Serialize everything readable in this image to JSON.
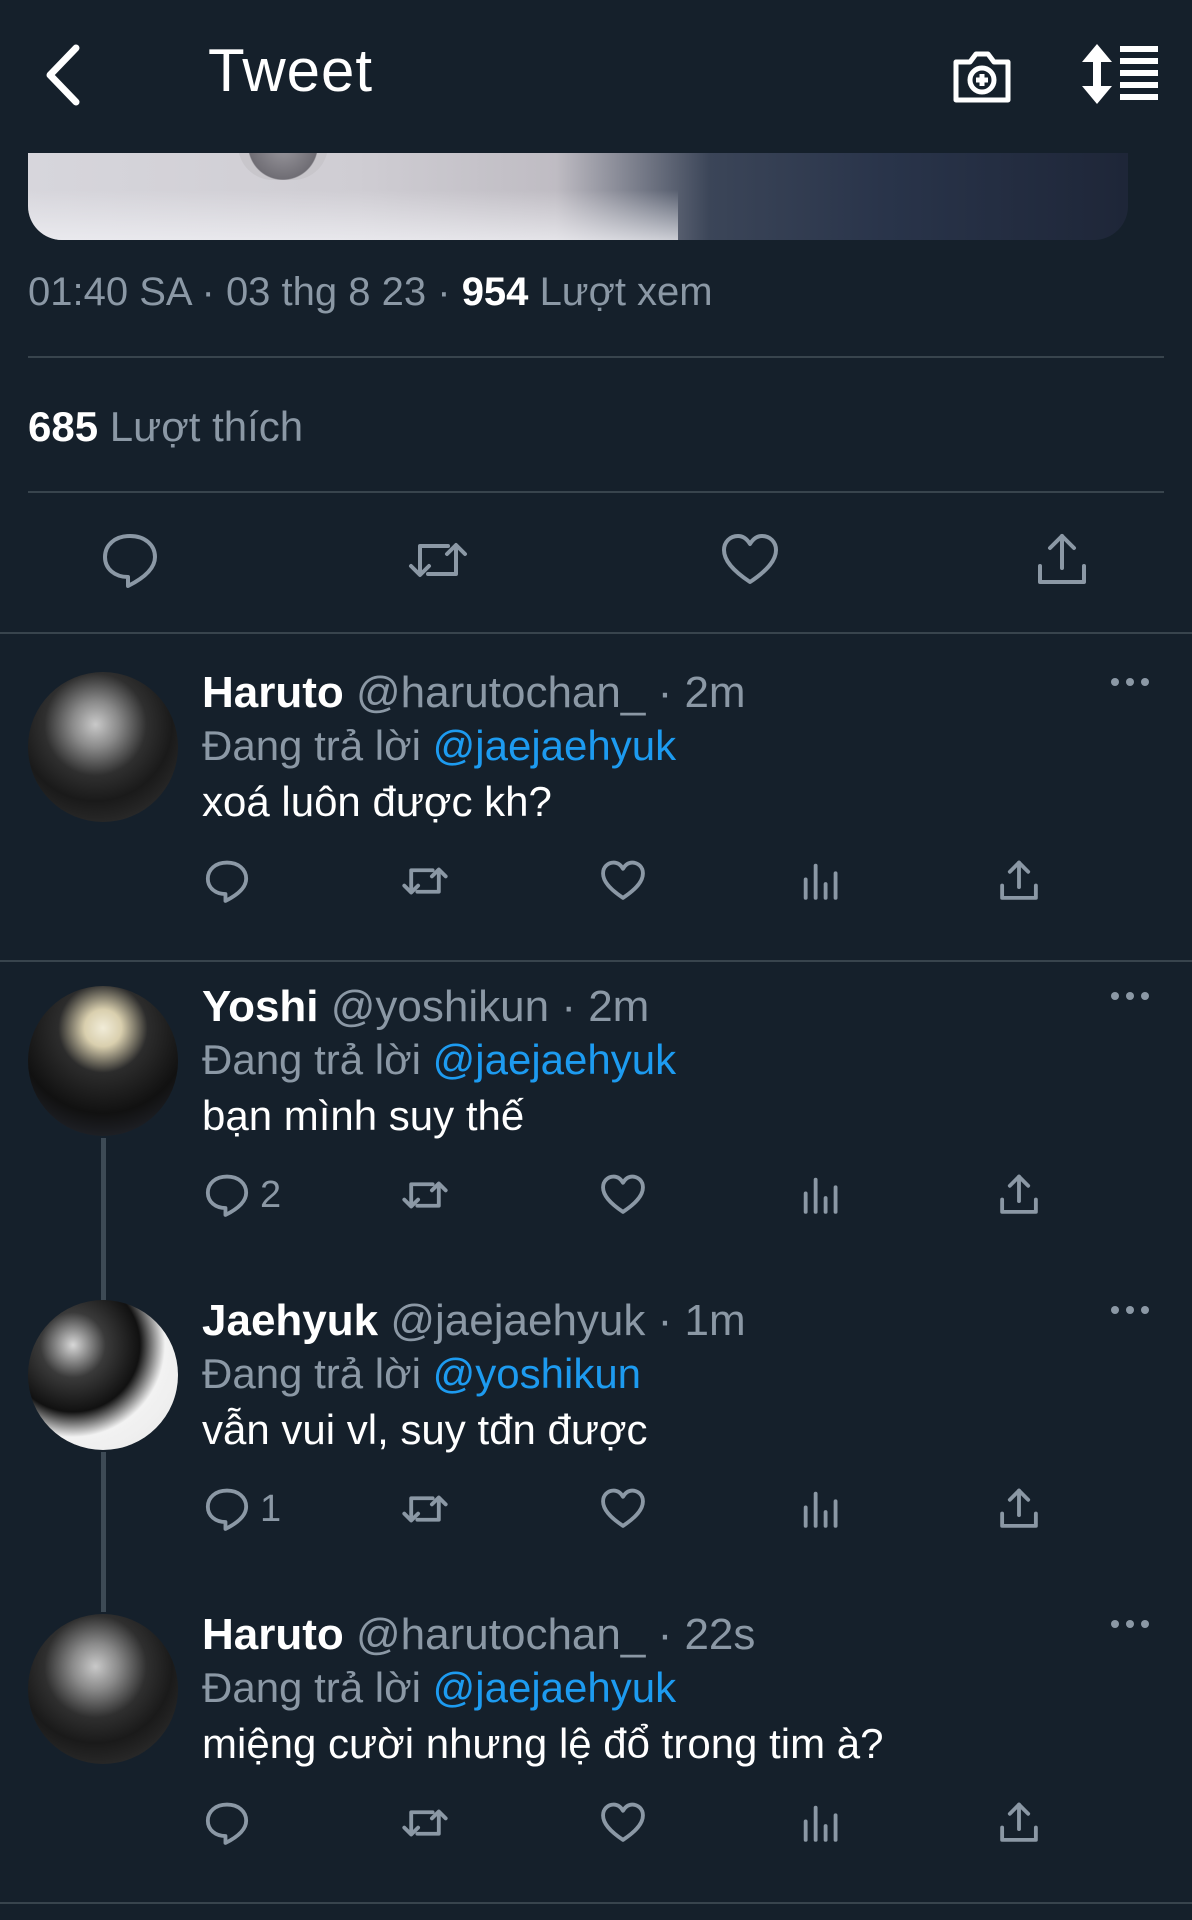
{
  "header": {
    "title": "Tweet",
    "back_icon": "chevron-left-icon",
    "camera_icon": "camera-plus-icon",
    "sort_icon": "sort-list-icon"
  },
  "tweet": {
    "time": "01:40 SA",
    "date": "03 thg 8 23",
    "views_count": "954",
    "views_label": "Lượt xem",
    "likes_count": "685",
    "likes_label": "Lượt thích"
  },
  "colors": {
    "background": "#15202b",
    "divider": "#38444d",
    "secondary_text": "#8b98a5",
    "link": "#1d9bf0"
  },
  "replies": [
    {
      "name": "Haruto",
      "handle": "@harutochan_",
      "time": "· 2m",
      "replying_prefix": "Đang trả lời",
      "replying_to": "@jaejaehyuk",
      "text": "xoá luôn được kh?",
      "reply_count": ""
    },
    {
      "name": "Yoshi",
      "handle": "@yoshikun",
      "time": "· 2m",
      "replying_prefix": "Đang trả lời",
      "replying_to": "@jaejaehyuk",
      "text": "bạn mình suy thế",
      "reply_count": "2"
    },
    {
      "name": "Jaehyuk",
      "handle": "@jaejaehyuk",
      "time": "· 1m",
      "replying_prefix": "Đang trả lời",
      "replying_to": "@yoshikun",
      "text": "vẫn vui vl, suy tđn được",
      "reply_count": "1"
    },
    {
      "name": "Haruto",
      "handle": "@harutochan_",
      "time": "· 22s",
      "replying_prefix": "Đang trả lời",
      "replying_to": "@jaejaehyuk",
      "text": "miệng cười nhưng lệ đổ trong tim à?",
      "reply_count": ""
    }
  ]
}
